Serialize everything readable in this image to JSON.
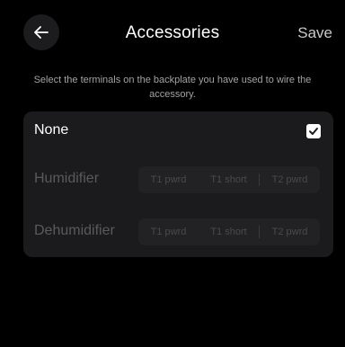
{
  "header": {
    "title": "Accessories",
    "save_label": "Save",
    "back_icon": "arrow-left-icon"
  },
  "instruction": "Select the terminals on the backplate you have used to wire the accessory.",
  "options": {
    "none": {
      "label": "None",
      "checked": true
    },
    "humidifier": {
      "label": "Humidifier",
      "terminals": [
        "T1 pwrd",
        "T1 short",
        "T2 pwrd"
      ]
    },
    "dehumidifier": {
      "label": "Dehumidifier",
      "terminals": [
        "T1 pwrd",
        "T1 short",
        "T2 pwrd"
      ]
    }
  },
  "colors": {
    "background": "#000000",
    "card": "#1b1b1d",
    "disabled_text": "#5a5a5c"
  }
}
